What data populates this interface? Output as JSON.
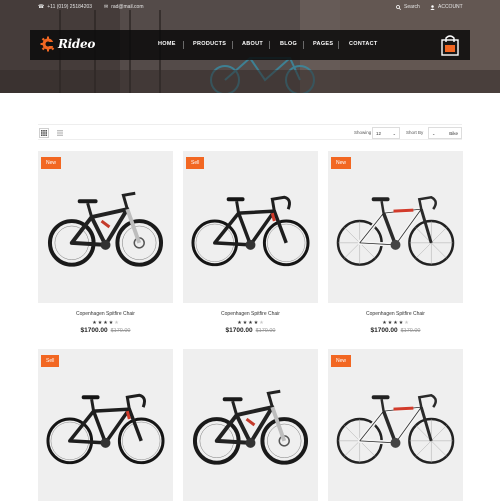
{
  "topbar": {
    "phone": "+11 (019) 25184203",
    "email": "rad@mail.com",
    "search_label": "Search",
    "account_label": "ACCOUNT"
  },
  "header": {
    "logo_text": "Rideo",
    "nav": [
      "HOME",
      "PRODUCTS",
      "ABOUT",
      "BLOG",
      "PAGES",
      "CONTACT"
    ],
    "brand_color": "#f26722"
  },
  "toolbar": {
    "showing_label": "Showing",
    "showing_value": "12",
    "sort_label": "Short By",
    "sort_value": "Bike"
  },
  "products": [
    {
      "badge": "New",
      "name": "Copenhagen Spitfire Chair",
      "rating": 4,
      "price": "$1700.00",
      "old_price": "$170.00",
      "bike": "mtb"
    },
    {
      "badge": "Sell",
      "name": "Copenhagen Spitfire Chair",
      "rating": 4,
      "price": "$1700.00",
      "old_price": "$170.00",
      "bike": "gravel"
    },
    {
      "badge": "New",
      "name": "Copenhagen Spitfire Chair",
      "rating": 4,
      "price": "$1700.00",
      "old_price": "$170.00",
      "bike": "road"
    },
    {
      "badge": "Sell",
      "name": "",
      "rating": 0,
      "price": "",
      "old_price": "",
      "bike": "gravel"
    },
    {
      "badge": "",
      "name": "",
      "rating": 0,
      "price": "",
      "old_price": "",
      "bike": "mtb"
    },
    {
      "badge": "New",
      "name": "",
      "rating": 0,
      "price": "",
      "old_price": "",
      "bike": "road"
    }
  ]
}
